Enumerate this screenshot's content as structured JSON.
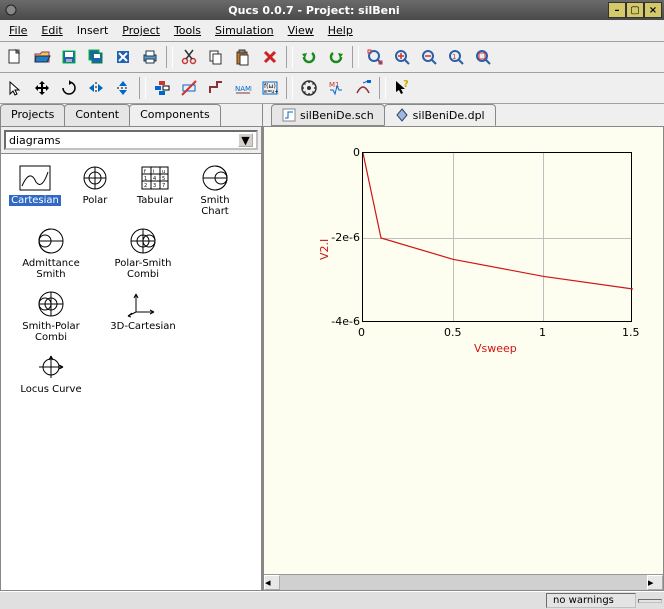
{
  "window": {
    "title": "Qucs 0.0.7 - Project: silBeni"
  },
  "menu": {
    "items": [
      "File",
      "Edit",
      "Insert",
      "Project",
      "Tools",
      "Simulation",
      "View",
      "Help"
    ]
  },
  "left": {
    "tabs": [
      "Projects",
      "Content",
      "Components"
    ],
    "active_tab": "Components",
    "combo": "diagrams",
    "palette": [
      {
        "name": "Cartesian",
        "sel": true
      },
      {
        "name": "Polar"
      },
      {
        "name": "Tabular"
      },
      {
        "name": "Smith Chart"
      },
      {
        "name": "Admittance Smith"
      },
      {
        "name": "Polar-Smith Combi"
      },
      {
        "name": "Smith-Polar Combi"
      },
      {
        "name": "3D-Cartesian"
      },
      {
        "name": "Locus Curve"
      }
    ]
  },
  "doc": {
    "tabs": [
      {
        "label": "silBeniDe.sch",
        "active": false
      },
      {
        "label": "silBeniDe.dpl",
        "active": true
      }
    ]
  },
  "status": {
    "msg": "no warnings"
  },
  "chart_data": {
    "type": "line",
    "x": [
      0,
      0.1,
      0.5,
      1,
      1.5
    ],
    "y": [
      0,
      -2e-06,
      -2.5e-06,
      -2.9e-06,
      -3.2e-06
    ],
    "xlabel": "Vsweep",
    "ylabel": "V2.I",
    "xlim": [
      0,
      1.5
    ],
    "ylim": [
      -4e-06,
      0
    ],
    "xticks": [
      0,
      0.5,
      1,
      1.5
    ],
    "yticks": [
      0,
      -2e-06,
      -4e-06
    ],
    "yticklabels": [
      "0",
      "-2e-6",
      "-4e-6"
    ]
  }
}
